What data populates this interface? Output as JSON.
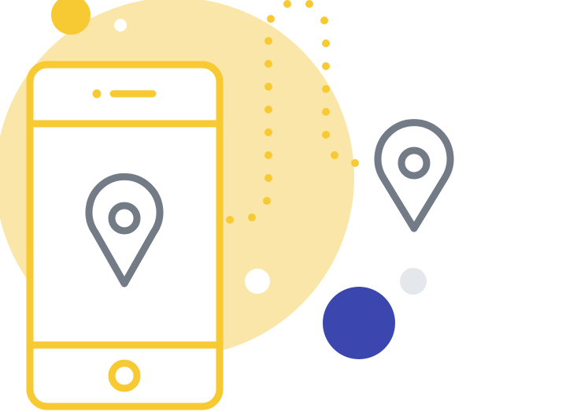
{
  "colors": {
    "background": "#ffffff",
    "blob": "#FAE6A8",
    "accent_yellow": "#F7C932",
    "pin_gray": "#737B87",
    "accent_blue": "#3B47AE",
    "light_gray": "#E4E7EB",
    "white": "#ffffff"
  },
  "icons": {
    "phone": "smartphone-icon",
    "pin_phone": "map-pin-icon",
    "pin_destination": "map-pin-icon",
    "route": "dotted-route-line"
  }
}
